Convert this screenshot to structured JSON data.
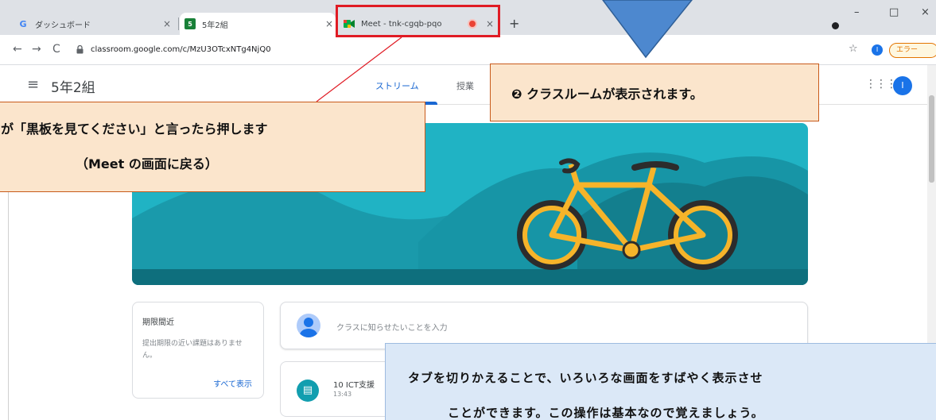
{
  "browser": {
    "tabs": [
      {
        "favicon": "G",
        "title": "ダッシュボード"
      },
      {
        "favicon": "5",
        "title": "5年2組"
      },
      {
        "favicon": "meet-icon",
        "title": "Meet - tnk-cgqb-pqo"
      }
    ],
    "close_glyph": "×",
    "new_tab": "+",
    "url": "classroom.google.com/c/MzU3OTcxNTg4NjQ0",
    "profile_initial": "I",
    "error_pill": "エラー"
  },
  "classroom": {
    "class_name": "5年2組",
    "tabs": [
      "ストリーム",
      "授業"
    ],
    "avatar_initial": "I",
    "due_card": {
      "title": "期限間近",
      "text": "提出期限の近い課題はありません。",
      "link": "すべて表示"
    },
    "post_placeholder": "クラスに知らせたいことを入力",
    "item": {
      "title": "10 ICT支援",
      "time": "13:43"
    }
  },
  "annotations": {
    "left_line1": "が「黒板を見てください」と言ったら押します",
    "left_line2": "（Meet の画面に戻る）",
    "right_number": "❷",
    "right_text": "クラスルームが表示されます。",
    "bottom_line1": "タブを切りかえることで、いろいろな画面をすばやく表示させ",
    "bottom_line2": "ことができます。この操作は基本なので覚えましょう。"
  },
  "colors": {
    "highlight_box": "#e01b24",
    "callout_orange_bg": "#fbe5cc",
    "callout_blue_bg": "#dbe8f7",
    "classroom_blue": "#1967d2",
    "banner_teal": "#1fb5c6"
  }
}
